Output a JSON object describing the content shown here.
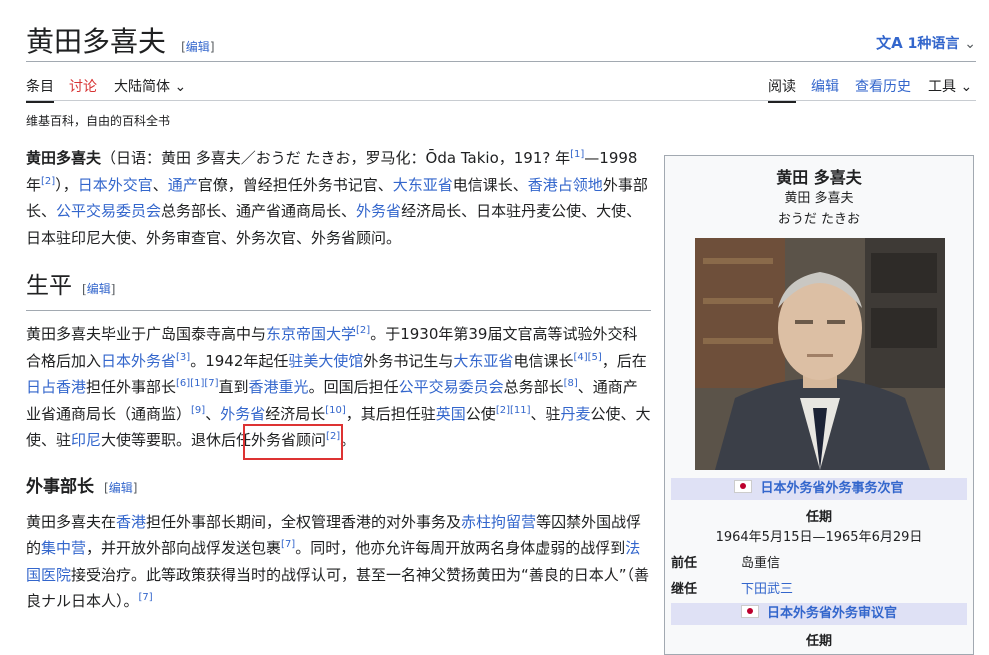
{
  "title": "黄田多喜夫",
  "edit_link": "编辑",
  "language_button": "1种语言",
  "tabs_left": [
    "条目",
    "讨论",
    "大陆简体"
  ],
  "tabs_right": [
    "阅读",
    "编辑",
    "查看历史",
    "工具"
  ],
  "tagline": "维基百科，自由的百科全书",
  "lead": {
    "name_bold": "黄田多喜夫",
    "t1": "（日语：黄田 多喜夫／おうだ たきお，罗马化：Ōda Takio，191? 年",
    "ref1": "[1]",
    "t2": "—1998年",
    "ref2": "[2]",
    "t3": "），",
    "l1": "日本外交官",
    "t4": "、",
    "l2": "通产",
    "t5": "官僚，曾经担任外务书记官、",
    "l3": "大东亚省",
    "t6": "电信课长、",
    "l4": "香港占领地",
    "t7": "外事部长、",
    "l5": "公平交易委员会",
    "t8": "总务部长、通产省通商局长、",
    "l6": "外务省",
    "t9": "经济局长、日本驻丹麦公使、大使、日本驻印尼大使、外务审查官、外务次官、外务省顾问。"
  },
  "section1": {
    "heading": "生平",
    "a": "黄田多喜夫毕业于广岛国泰寺高中与",
    "l1": "东京帝国大学",
    "r1": "[2]",
    "b": "。于1930年第39届文官高等试验外交科合格后加入",
    "l2": "日本外务省",
    "r2": "[3]",
    "c": "。1942年起任",
    "l3": "驻美大使馆",
    "d": "外务书记生与",
    "l4": "大东亚省",
    "e": "电信课长",
    "r3": "[4][5]",
    "f": "，后在",
    "l5": "日占香港",
    "g": "担任外事部长",
    "r4": "[6][1][7]",
    "h": "直到",
    "l6": "香港重光",
    "i": "。回国后担任",
    "l7": "公平交易委员会",
    "j": "总务部长",
    "r5": "[8]",
    "k": "、通商产业省通商局长（通商监）",
    "r6": "[9]",
    "m": "、",
    "l8": "外务省",
    "n": "经济局长",
    "r7": "[10]",
    "o": "，其后担任驻",
    "l9": "英国",
    "p": "公使",
    "r8": "[2][11]",
    "q": "、驻",
    "l10": "丹麦",
    "s": "公使、大使、驻",
    "l11": "印尼",
    "t": "大使等要职。退休后任外务省顾问",
    "r9": "[2]",
    "u": "。"
  },
  "section2": {
    "heading": "外事部长",
    "a": "黄田多喜夫在",
    "l1": "香港",
    "b": "担任外事部长期间，全权管理香港的对外事务及",
    "l2": "赤柱拘留营",
    "c": "等囚禁外国战俘的",
    "l3": "集中营",
    "d": "，并开放外部向战俘发送包裹",
    "r1": "[7]",
    "e": "。同时，他亦允许每周开放两名身体虚弱的战俘到",
    "l4": "法国医院",
    "f": "接受治疗。此等政策获得当时的战俘认可，甚至一名神父赞扬黄田为“善良的日本人”（善良ナル日本人）。",
    "r2": "[7]"
  },
  "infobox": {
    "name": "黄田 多喜夫",
    "name_jp": "黄田 多喜夫",
    "name_kana": "おうだ たきお",
    "office1": "日本外务省外务事务次官",
    "term_label": "任期",
    "term1": "1964年5月15日—1965年6月29日",
    "pred_label": "前任",
    "pred": "岛重信",
    "succ_label": "继任",
    "succ": "下田武三",
    "office2": "日本外务省外务审议官",
    "term_label2": "任期"
  }
}
